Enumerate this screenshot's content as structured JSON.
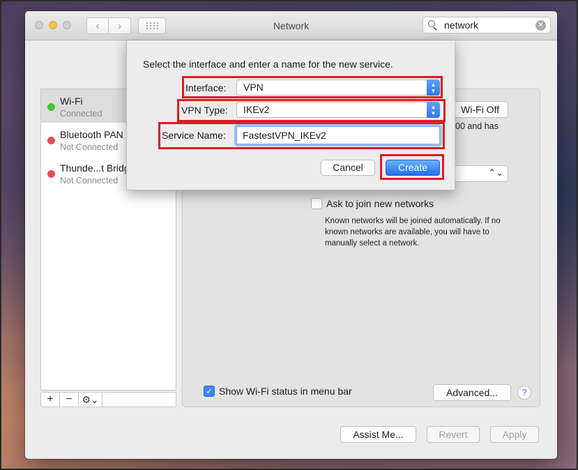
{
  "window": {
    "title": "Network"
  },
  "search": {
    "value": "network"
  },
  "services": [
    {
      "name": "Wi-Fi",
      "status": "Connected",
      "dot_color": "#4cc13a"
    },
    {
      "name": "Bluetooth PAN",
      "status": "Not Connected",
      "dot_color": "#e3504d"
    },
    {
      "name": "Thunde...t Bridge",
      "status": "Not Connected",
      "dot_color": "#e3504d"
    }
  ],
  "sidebar_toolbar": {
    "add": "+",
    "remove": "−",
    "gear": "⚙⌄"
  },
  "main": {
    "wifi_off_button": "Wi-Fi Off",
    "status_partial": "00 and has",
    "ask_join_label": "Ask to join new networks",
    "ask_join_desc": "Known networks will be joined automatically. If no known networks are available, you will have to manually select a network.",
    "show_wifi_label": "Show Wi-Fi status in menu bar",
    "advanced_button": "Advanced...",
    "help_glyph": "?"
  },
  "bottom": {
    "assist": "Assist Me...",
    "revert": "Revert",
    "apply": "Apply"
  },
  "sheet": {
    "prompt": "Select the interface and enter a name for the new service.",
    "interface_label": "Interface:",
    "interface_value": "VPN",
    "vpn_type_label": "VPN Type:",
    "vpn_type_value": "IKEv2",
    "service_name_label": "Service Name:",
    "service_name_value": "FastestVPN_IKEv2",
    "cancel": "Cancel",
    "create": "Create"
  },
  "colors": {
    "highlight": "#e01b24",
    "accent": "#2f78ef"
  }
}
